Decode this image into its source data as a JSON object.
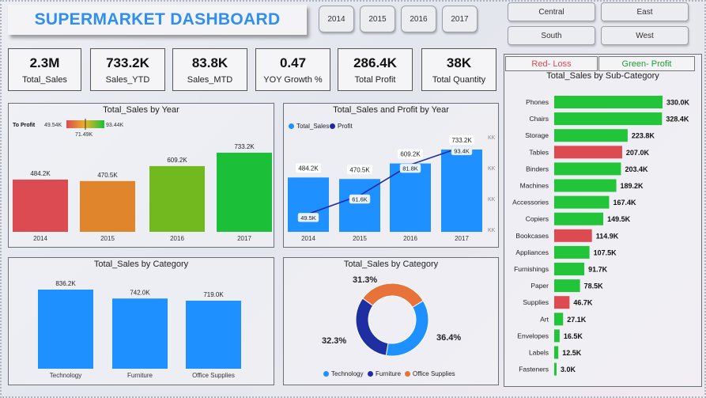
{
  "title": "SUPERMARKET DASHBOARD",
  "years": [
    "2014",
    "2015",
    "2016",
    "2017"
  ],
  "regions": [
    "Central",
    "East",
    "South",
    "West"
  ],
  "kpis": [
    {
      "value": "2.3M",
      "label": "Total_Sales"
    },
    {
      "value": "733.2K",
      "label": "Sales_YTD"
    },
    {
      "value": "83.8K",
      "label": "Sales_MTD"
    },
    {
      "value": "0.47",
      "label": "YOY Growth %"
    },
    {
      "value": "286.4K",
      "label": "Total Profit"
    },
    {
      "value": "38K",
      "label": "Total Quantity"
    }
  ],
  "legend_loss": "Red- Loss",
  "legend_profit": "Green- Profit",
  "colors": {
    "accent": "#2f8ff0",
    "bar_blue": "#1e90ff",
    "line_navy": "#1f2a9c",
    "loss_red": "#dc4a52",
    "profit_green": "#22c53a",
    "orange": "#e07b39",
    "navy": "#1f2ea0"
  },
  "chart_data": [
    {
      "id": "sales-by-year",
      "type": "bar",
      "title": "Total_Sales by Year",
      "categories": [
        "2014",
        "2015",
        "2016",
        "2017"
      ],
      "values": [
        484.2,
        470.5,
        609.2,
        733.2
      ],
      "value_labels": [
        "484.2K",
        "470.5K",
        "609.2K",
        "733.2K"
      ],
      "bar_colors": [
        "#dc4a52",
        "#e0852b",
        "#72b81f",
        "#1bbf38"
      ],
      "color_legend": {
        "title": "To Profit",
        "min": "49.54K",
        "mid": "71.49K",
        "max": "93.44K"
      },
      "ylim": [
        0,
        800
      ]
    },
    {
      "id": "sales-profit-by-year",
      "type": "bar",
      "title": "Total_Sales and Profit by Year",
      "categories": [
        "2014",
        "2015",
        "2016",
        "2017"
      ],
      "series": [
        {
          "name": "Total_Sales",
          "values": [
            484.2,
            470.5,
            609.2,
            733.2
          ],
          "labels": [
            "484.2K",
            "470.5K",
            "609.2K",
            "733.2K"
          ]
        },
        {
          "name": "Profit",
          "values": [
            49.5,
            61.6,
            81.8,
            93.4
          ],
          "labels": [
            "49.5K",
            "61.6K",
            "81.8K",
            "93.4K"
          ]
        }
      ],
      "right_axis_ticks": [
        "KK",
        "KK",
        "KK",
        "KK",
        "KK"
      ]
    },
    {
      "id": "sales-by-category-bar",
      "type": "bar",
      "title": "Total_Sales by Category",
      "categories": [
        "Technology",
        "Furniture",
        "Office Supplies"
      ],
      "values": [
        836.2,
        742.0,
        719.0
      ],
      "value_labels": [
        "836.2K",
        "742.0K",
        "719.0K"
      ],
      "ylim": [
        0,
        900
      ]
    },
    {
      "id": "sales-by-category-donut",
      "type": "pie",
      "title": "Total_Sales by Category",
      "categories": [
        "Technology",
        "Furniture",
        "Office Supplies"
      ],
      "values": [
        36.4,
        32.3,
        31.3
      ],
      "value_labels": [
        "36.4%",
        "32.3%",
        "31.3%"
      ],
      "slice_colors": [
        "#1e90ff",
        "#1f2ea0",
        "#e8733a"
      ]
    },
    {
      "id": "sales-by-subcategory",
      "type": "bar",
      "title": "Total_Sales by Sub-Category",
      "categories": [
        "Phones",
        "Chairs",
        "Storage",
        "Tables",
        "Binders",
        "Machines",
        "Accessories",
        "Copiers",
        "Bookcases",
        "Appliances",
        "Furnishings",
        "Paper",
        "Supplies",
        "Art",
        "Envelopes",
        "Labels",
        "Fasteners"
      ],
      "values": [
        330.0,
        328.4,
        223.8,
        207.0,
        203.4,
        189.2,
        167.4,
        149.5,
        114.9,
        107.5,
        91.7,
        78.5,
        46.7,
        27.1,
        16.5,
        12.5,
        3.0
      ],
      "value_labels": [
        "330.0K",
        "328.4K",
        "223.8K",
        "207.0K",
        "203.4K",
        "189.2K",
        "167.4K",
        "149.5K",
        "114.9K",
        "107.5K",
        "91.7K",
        "78.5K",
        "46.7K",
        "27.1K",
        "16.5K",
        "12.5K",
        "3.0K"
      ],
      "loss": [
        false,
        false,
        false,
        true,
        false,
        false,
        false,
        false,
        true,
        false,
        false,
        false,
        true,
        false,
        false,
        false,
        false
      ]
    }
  ]
}
